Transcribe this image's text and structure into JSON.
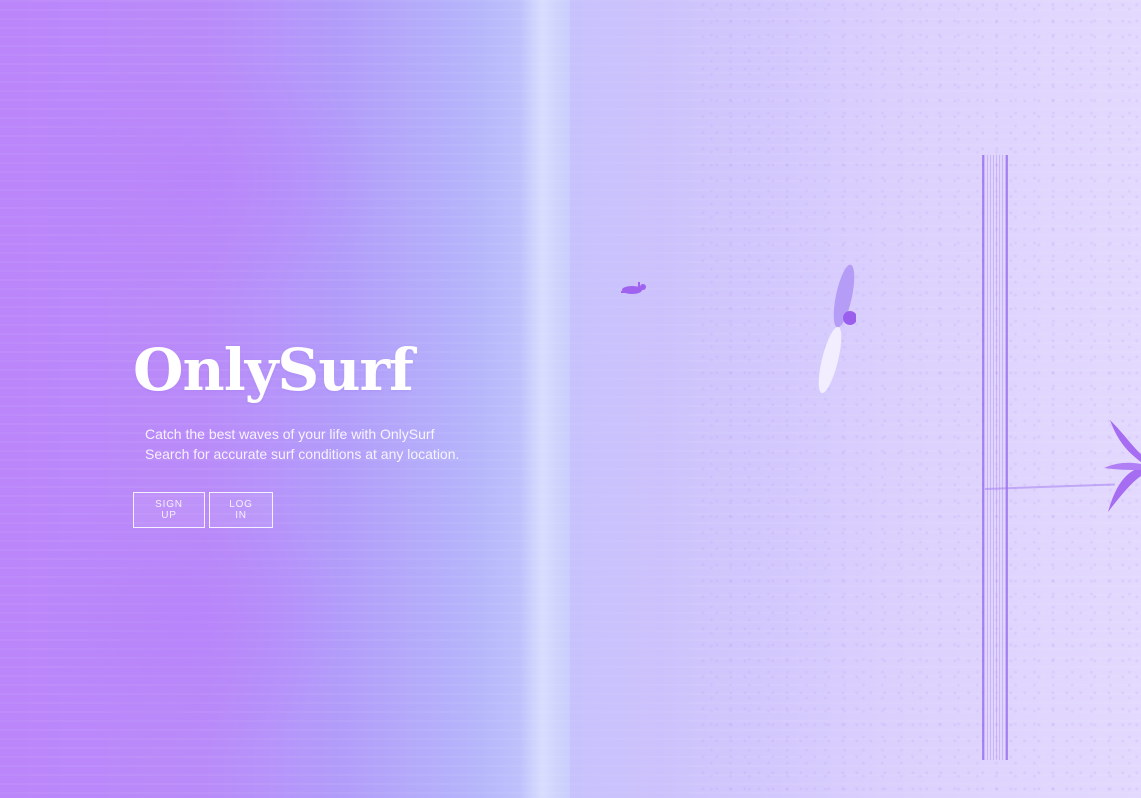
{
  "brand": {
    "logo_text": "OnlySurf"
  },
  "hero": {
    "tagline_line1": "Catch the best waves of your life with OnlySurf",
    "tagline_line2": "Search for accurate surf conditions at any location."
  },
  "actions": {
    "signup_label": "SIGN UP",
    "login_label": "LOG IN"
  },
  "colors": {
    "accent": "#bb86fa",
    "text": "#ffffff"
  }
}
